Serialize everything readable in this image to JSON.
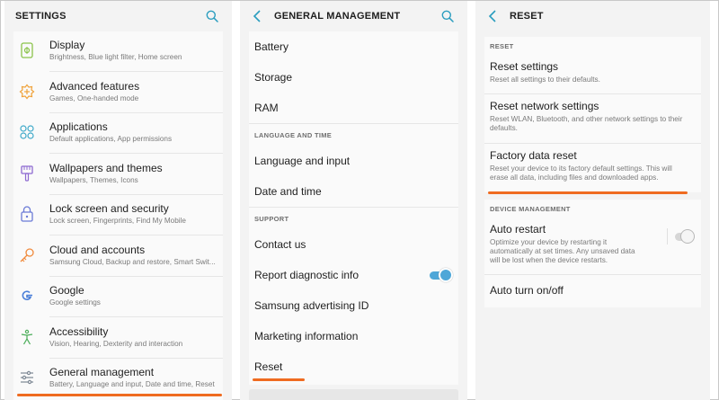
{
  "colors": {
    "accent": "#2a9dbf",
    "highlight": "#ef6b20",
    "toggle_on": "#4ea7d8"
  },
  "settings": {
    "title": "SETTINGS",
    "items": [
      {
        "icon": "display-icon",
        "title": "Display",
        "desc": "Brightness, Blue light filter, Home screen"
      },
      {
        "icon": "advanced-features-icon",
        "title": "Advanced features",
        "desc": "Games, One-handed mode"
      },
      {
        "icon": "applications-icon",
        "title": "Applications",
        "desc": "Default applications, App permissions"
      },
      {
        "icon": "wallpaper-icon",
        "title": "Wallpapers and themes",
        "desc": "Wallpapers, Themes, Icons"
      },
      {
        "icon": "lock-icon",
        "title": "Lock screen and security",
        "desc": "Lock screen, Fingerprints, Find My Mobile"
      },
      {
        "icon": "key-icon",
        "title": "Cloud and accounts",
        "desc": "Samsung Cloud, Backup and restore, Smart Swit..."
      },
      {
        "icon": "google-icon",
        "title": "Google",
        "desc": "Google settings"
      },
      {
        "icon": "accessibility-icon",
        "title": "Accessibility",
        "desc": "Vision, Hearing, Dexterity and interaction"
      },
      {
        "icon": "general-management-icon",
        "title": "General management",
        "desc": "Battery, Language and input, Date and time, Reset"
      }
    ]
  },
  "general": {
    "title": "GENERAL MANAGEMENT",
    "top_items": [
      "Battery",
      "Storage",
      "RAM"
    ],
    "section_language": "LANGUAGE AND TIME",
    "language_items": [
      "Language and input",
      "Date and time"
    ],
    "section_support": "SUPPORT",
    "support_items": [
      "Contact us",
      "Report diagnostic info",
      "Samsung advertising ID",
      "Marketing information",
      "Reset"
    ],
    "report_diagnostic_enabled": true
  },
  "reset": {
    "title": "RESET",
    "section_reset": "RESET",
    "items": [
      {
        "title": "Reset settings",
        "desc": "Reset all settings to their defaults."
      },
      {
        "title": "Reset network settings",
        "desc": "Reset WLAN, Bluetooth, and other network settings to their defaults."
      },
      {
        "title": "Factory data reset",
        "desc": "Reset your device to its factory default settings. This will erase all data, including files and downloaded apps."
      }
    ],
    "section_device": "DEVICE MANAGEMENT",
    "auto_restart": {
      "title": "Auto restart",
      "desc": "Optimize your device by restarting it automatically at set times. Any unsaved data will be lost when the device restarts.",
      "enabled": false
    },
    "auto_turn": {
      "title": "Auto turn on/off"
    }
  }
}
